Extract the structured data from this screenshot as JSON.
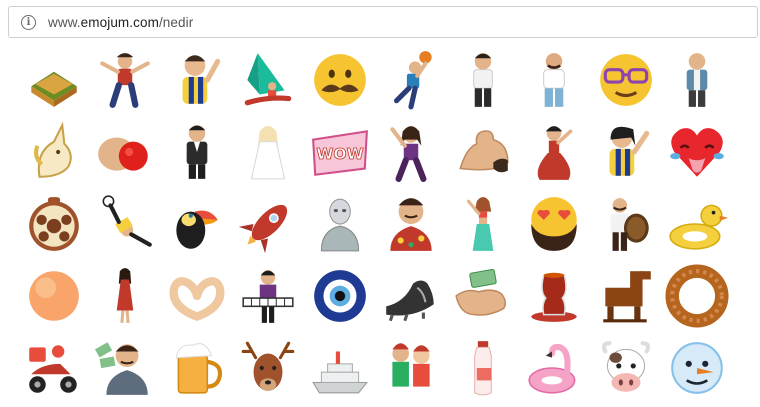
{
  "browser": {
    "url_prefix": "www.",
    "url_host": "emojum.com",
    "url_path": "/nedir",
    "info_icon": "info-circle-icon"
  },
  "emojis": [
    [
      "baklava-icon",
      "dancer-man-icon",
      "football-fan-man-icon",
      "windsurfer-icon",
      "mustache-face-icon",
      "basketball-player-icon",
      "man-standing-icon",
      "man-tanktop-icon",
      "glasses-face-icon",
      "man-cardigan-icon"
    ],
    [
      "unicorn-icon",
      "hand-red-ball-icon",
      "man-suit-icon",
      "bride-icon",
      "wow-sign-icon",
      "hippie-dancer-icon",
      "arm-flex-icon",
      "flamenco-dancer-icon",
      "football-fan-woman-icon",
      "heart-tongue-crying-icon"
    ],
    [
      "meatball-plate-icon",
      "bicycle-kick-icon",
      "toucan-icon",
      "rocket-icon",
      "robot-bust-icon",
      "man-hawaiian-shirt-icon",
      "belly-dancer-icon",
      "heart-eyes-bearded-icon",
      "drummer-icon",
      "rubber-duck-float-icon"
    ],
    [
      "peach-icon",
      "woman-red-dress-icon",
      "hands-heart-icon",
      "keyboard-player-icon",
      "evil-eye-bead-icon",
      "football-boot-icon",
      "hand-money-icon",
      "turkish-tea-icon",
      "trojan-horse-icon",
      "simit-icon"
    ],
    [
      "delivery-scooter-icon",
      "money-fan-man-icon",
      "beer-mug-icon",
      "deer-icon",
      "ship-icon",
      "santa-couple-icon",
      "milk-bottle-icon",
      "flamingo-float-icon",
      "cow-icon",
      "snowman-face-icon"
    ]
  ]
}
